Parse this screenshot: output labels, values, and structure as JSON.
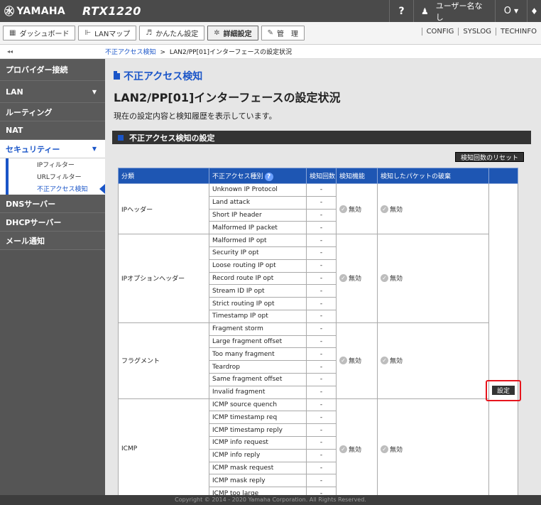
{
  "header": {
    "brand": "YAMAHA",
    "model": "RTX1220",
    "help_label": "?",
    "user_label": "ユーザー名なし",
    "status_symbol": "O",
    "icons": [
      "yamaha-logo-icon",
      "person-icon",
      "bell-icon",
      "chevron-down-icon"
    ]
  },
  "nav": {
    "tabs": [
      {
        "label": "ダッシュボード",
        "icon": "▦",
        "active": false
      },
      {
        "label": "LANマップ",
        "icon": "⊩",
        "active": false
      },
      {
        "label": "かんたん設定",
        "icon": "♬",
        "active": false
      },
      {
        "label": "詳細設定",
        "icon": "✲",
        "active": true
      },
      {
        "label": "管　理",
        "icon": "✎",
        "active": false
      }
    ],
    "links": [
      "CONFIG",
      "SYSLOG",
      "TECHINFO"
    ]
  },
  "breadcrumb": {
    "collapse": "◂◂",
    "root": "不正アクセス検知",
    "separator": ">",
    "current": "LAN2/PP[01]インターフェースの設定状況"
  },
  "sidebar": {
    "items": [
      {
        "label": "プロバイダー接続",
        "caret": ""
      },
      {
        "label": "LAN",
        "caret": "▼"
      },
      {
        "label": "ルーティング",
        "caret": ""
      },
      {
        "label": "NAT",
        "caret": ""
      },
      {
        "label": "セキュリティー",
        "caret": "▼"
      },
      {
        "label": "DNSサーバー",
        "caret": ""
      },
      {
        "label": "DHCPサーバー",
        "caret": ""
      },
      {
        "label": "メール通知",
        "caret": ""
      }
    ],
    "security_sub": [
      "IPフィルター",
      "URLフィルター",
      "不正アクセス検知"
    ]
  },
  "main": {
    "title": "不正アクセス検知",
    "subtitle": "LAN2/PP[01]インターフェースの設定状況",
    "description": "現在の設定内容と検知履歴を表示しています。",
    "section_title": "不正アクセス検知の設定",
    "reset_label": "検知回数のリセット",
    "table": {
      "headers": [
        "分類",
        "不正アクセス種別",
        "検知回数",
        "検知機能",
        "検知したパケットの破棄"
      ],
      "help_symbol": "?",
      "edit_label": "設定",
      "groups": [
        {
          "category": "IPヘッダー",
          "function": "無効",
          "discard": "無効",
          "items": [
            "Unknown IP Protocol",
            "Land attack",
            "Short IP header",
            "Malformed IP packet"
          ]
        },
        {
          "category": "IPオプションヘッダー",
          "function": "無効",
          "discard": "無効",
          "items": [
            "Malformed IP opt",
            "Security IP opt",
            "Loose routing IP opt",
            "Record route IP opt",
            "Stream ID IP opt",
            "Strict routing IP opt",
            "Timestamp IP opt"
          ]
        },
        {
          "category": "フラグメント",
          "function": "無効",
          "discard": "無効",
          "items": [
            "Fragment storm",
            "Large fragment offset",
            "Too many fragment",
            "Teardrop",
            "Same fragment offset",
            "Invalid fragment"
          ]
        },
        {
          "category": "ICMP",
          "function": "無効",
          "discard": "無効",
          "items": [
            "ICMP source quench",
            "ICMP timestamp req",
            "ICMP timestamp reply",
            "ICMP info request",
            "ICMP info reply",
            "ICMP mask request",
            "ICMP mask reply",
            "ICMP too large"
          ]
        }
      ],
      "count_value": "-"
    }
  },
  "footer": "Copyright © 2014 - 2020 Yamaha Corporation. All Rights Reserved."
}
